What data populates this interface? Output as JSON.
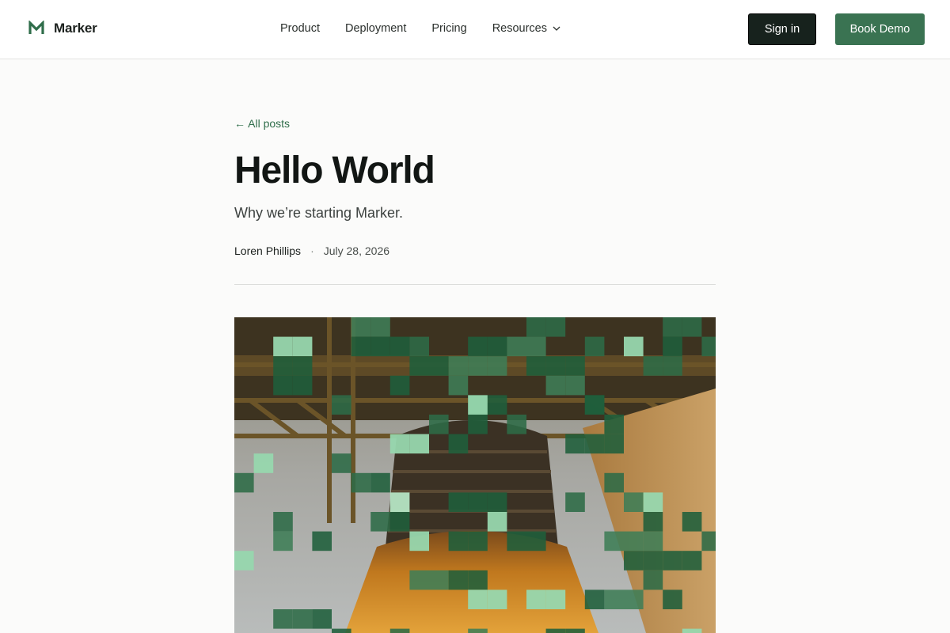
{
  "header": {
    "brand": {
      "name": "Marker",
      "logo_icon": "m-logo-icon"
    },
    "nav": [
      {
        "label": "Product"
      },
      {
        "label": "Deployment"
      },
      {
        "label": "Pricing"
      },
      {
        "label": "Resources",
        "icon": "chevron-down-icon"
      }
    ],
    "sign_in_label": "Sign in",
    "book_demo_label": "Book Demo"
  },
  "post": {
    "back_link": "← All posts",
    "title": "Hello World",
    "subtitle": "Why we’re starting Marker.",
    "author": "Loren Phillips",
    "separator": "·",
    "date": "July 28, 2026"
  },
  "hero_image": {
    "subject": "rocket engine inside a launch structure with pixelated green mosaic overlay"
  },
  "colors": {
    "brand_green": "#3a7352",
    "dark_button": "#17221d",
    "link_green": "#2f6d4a",
    "page_bg": "#fbfbfa"
  }
}
